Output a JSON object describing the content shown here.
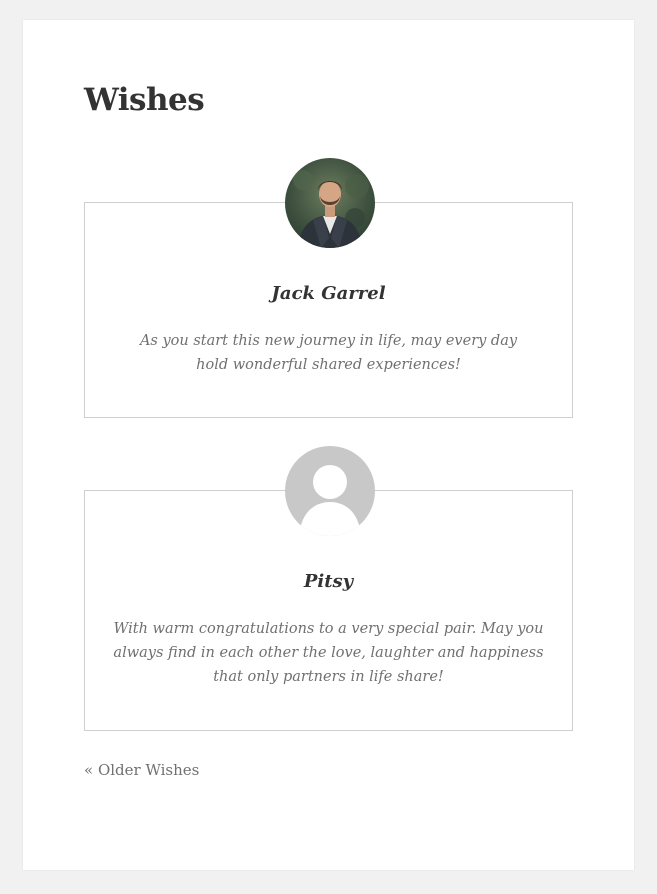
{
  "page": {
    "title": "Wishes"
  },
  "wishes": [
    {
      "name": "Jack Garrel",
      "message": "As you start this new journey in life, may every day hold wonderful shared experiences!",
      "avatar": "user-photo-avatar"
    },
    {
      "name": "Pitsy",
      "message": "With warm congratulations to a very special pair. May you always find in each other the love, laughter and happiness that only partners in life share!",
      "avatar": "default-avatar-icon"
    }
  ],
  "pagination": {
    "older_label": "« Older Wishes"
  },
  "colors": {
    "background": "#f1f1f1",
    "card": "#ffffff",
    "border": "#cfcfcf",
    "title": "#333333",
    "muted_text": "#707070",
    "default_avatar": "#c8c8c8"
  }
}
